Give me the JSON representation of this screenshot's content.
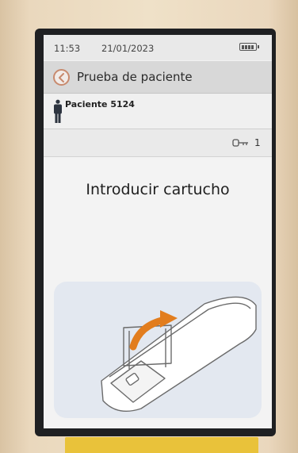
{
  "status_bar": {
    "time": "11:53",
    "date": "21/01/2023",
    "battery_icon": "battery-full-icon"
  },
  "header": {
    "back_icon": "chevron-left-icon",
    "title": "Prueba de paciente"
  },
  "patient": {
    "icon": "person-icon",
    "label": "Paciente 5124"
  },
  "cartridge": {
    "icon": "key-icon",
    "count": "1"
  },
  "main": {
    "instruction": "Introducir cartucho"
  },
  "colors": {
    "accent": "#c88a6e",
    "arrow": "#e27d1e",
    "title_bar": "#d8d8d8",
    "illustration_bg": "#e3e8f0"
  }
}
